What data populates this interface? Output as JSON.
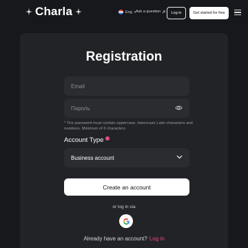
{
  "header": {
    "logo_text": "Charla",
    "language": "Eng",
    "ask_link": "Ask a question",
    "login_label": "Log in",
    "get_started_label": "Get started for free"
  },
  "form": {
    "title": "Registration",
    "email_placeholder": "Email",
    "password_placeholder": "Пароль",
    "password_hint": "* The password must contain uppercase, lowercase Latin characters and numbers. Minimum of 6 characters",
    "account_type_label": "Account Type",
    "account_type_value": "Business account",
    "create_button": "Create an account",
    "or_text": "or log in via",
    "already_text": "Already have an account?",
    "login_link": "Log in"
  },
  "colors": {
    "background": "#17181b",
    "card": "#222327",
    "field": "#2b2c30",
    "accent": "#e84a8a"
  },
  "icons": [
    "sparkle-icon",
    "flag-icon",
    "external-link-icon",
    "menu-icon",
    "eye-icon",
    "info-badge-icon",
    "chevron-down-icon",
    "google-icon"
  ]
}
